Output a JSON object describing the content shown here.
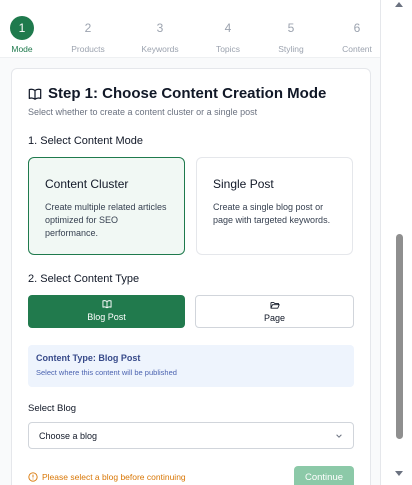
{
  "steps": [
    {
      "num": "1",
      "label": "Mode",
      "active": true
    },
    {
      "num": "2",
      "label": "Products",
      "active": false
    },
    {
      "num": "3",
      "label": "Keywords",
      "active": false
    },
    {
      "num": "4",
      "label": "Topics",
      "active": false
    },
    {
      "num": "5",
      "label": "Styling",
      "active": false
    },
    {
      "num": "6",
      "label": "Content",
      "active": false
    }
  ],
  "header": {
    "title": "Step 1: Choose Content Creation Mode",
    "subtitle": "Select whether to create a content cluster or a single post",
    "icon": "book-open-icon"
  },
  "content_mode": {
    "section_label": "1. Select Content Mode",
    "options": [
      {
        "title": "Content Cluster",
        "description": "Create multiple related articles optimized for SEO performance.",
        "selected": true
      },
      {
        "title": "Single Post",
        "description": "Create a single blog post or page with targeted keywords.",
        "selected": false
      }
    ]
  },
  "content_type": {
    "section_label": "2. Select Content Type",
    "options": [
      {
        "label": "Blog Post",
        "icon": "book-open-icon",
        "selected": true
      },
      {
        "label": "Page",
        "icon": "folder-open-icon",
        "selected": false
      }
    ]
  },
  "info": {
    "title": "Content Type: Blog Post",
    "subtitle": "Select where this content will be published"
  },
  "blog_select": {
    "label": "Select Blog",
    "value": "Choose a blog"
  },
  "footer": {
    "warning": "Please select a blog before continuing",
    "continue_label": "Continue"
  },
  "colors": {
    "accent": "#1f7a4d",
    "accent_disabled": "#8cc9a8",
    "warning": "#d97706",
    "info_bg": "#eef4fd"
  }
}
